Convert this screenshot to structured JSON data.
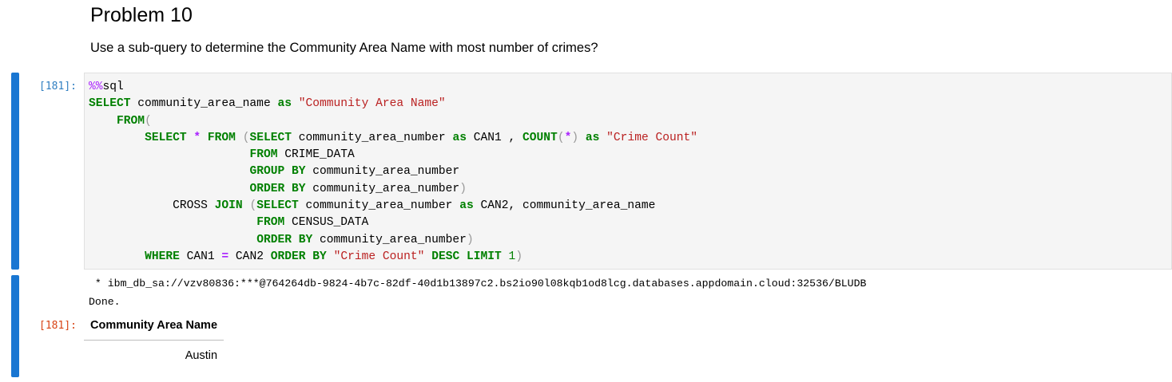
{
  "markdown": {
    "title": "Problem 10",
    "question": "Use a sub-query to determine the Community Area Name with most number of crimes?"
  },
  "cell": {
    "input_prompt": "[181]:",
    "output_prompt": "[181]:",
    "code_lines": [
      [
        [
          "magic",
          "%%"
        ],
        [
          "plain",
          "sql"
        ]
      ],
      [
        [
          "kw",
          "SELECT"
        ],
        [
          "plain",
          " community_area_name "
        ],
        [
          "kw",
          "as"
        ],
        [
          "plain",
          " "
        ],
        [
          "str",
          "\"Community Area Name\""
        ]
      ],
      [
        [
          "plain",
          "    "
        ],
        [
          "kw",
          "FROM"
        ],
        [
          "paren",
          "("
        ]
      ],
      [
        [
          "plain",
          "        "
        ],
        [
          "kw",
          "SELECT"
        ],
        [
          "plain",
          " "
        ],
        [
          "op",
          "*"
        ],
        [
          "plain",
          " "
        ],
        [
          "kw",
          "FROM"
        ],
        [
          "plain",
          " "
        ],
        [
          "paren",
          "("
        ],
        [
          "kw",
          "SELECT"
        ],
        [
          "plain",
          " community_area_number "
        ],
        [
          "kw",
          "as"
        ],
        [
          "plain",
          " CAN1 , "
        ],
        [
          "kw",
          "COUNT"
        ],
        [
          "paren",
          "("
        ],
        [
          "op",
          "*"
        ],
        [
          "paren",
          ")"
        ],
        [
          "plain",
          " "
        ],
        [
          "kw",
          "as"
        ],
        [
          "plain",
          " "
        ],
        [
          "str",
          "\"Crime Count\""
        ]
      ],
      [
        [
          "plain",
          "                       "
        ],
        [
          "kw",
          "FROM"
        ],
        [
          "plain",
          " CRIME_DATA"
        ]
      ],
      [
        [
          "plain",
          "                       "
        ],
        [
          "kw",
          "GROUP"
        ],
        [
          "plain",
          " "
        ],
        [
          "kw",
          "BY"
        ],
        [
          "plain",
          " community_area_number"
        ]
      ],
      [
        [
          "plain",
          "                       "
        ],
        [
          "kw",
          "ORDER"
        ],
        [
          "plain",
          " "
        ],
        [
          "kw",
          "BY"
        ],
        [
          "plain",
          " community_area_number"
        ],
        [
          "paren",
          ")"
        ]
      ],
      [
        [
          "plain",
          "            CROSS "
        ],
        [
          "kw",
          "JOIN"
        ],
        [
          "plain",
          " "
        ],
        [
          "paren",
          "("
        ],
        [
          "kw",
          "SELECT"
        ],
        [
          "plain",
          " community_area_number "
        ],
        [
          "kw",
          "as"
        ],
        [
          "plain",
          " CAN2, community_area_name"
        ]
      ],
      [
        [
          "plain",
          "                        "
        ],
        [
          "kw",
          "FROM"
        ],
        [
          "plain",
          " CENSUS_DATA"
        ]
      ],
      [
        [
          "plain",
          "                        "
        ],
        [
          "kw",
          "ORDER"
        ],
        [
          "plain",
          " "
        ],
        [
          "kw",
          "BY"
        ],
        [
          "plain",
          " community_area_number"
        ],
        [
          "paren",
          ")"
        ]
      ],
      [
        [
          "plain",
          "        "
        ],
        [
          "kw",
          "WHERE"
        ],
        [
          "plain",
          " CAN1 "
        ],
        [
          "op",
          "="
        ],
        [
          "plain",
          " CAN2 "
        ],
        [
          "kw",
          "ORDER"
        ],
        [
          "plain",
          " "
        ],
        [
          "kw",
          "BY"
        ],
        [
          "plain",
          " "
        ],
        [
          "str",
          "\"Crime Count\""
        ],
        [
          "plain",
          " "
        ],
        [
          "kw",
          "DESC"
        ],
        [
          "plain",
          " "
        ],
        [
          "kw",
          "LIMIT"
        ],
        [
          "plain",
          " "
        ],
        [
          "num",
          "1"
        ],
        [
          "paren",
          ")"
        ]
      ]
    ],
    "output": {
      "connection": " * ibm_db_sa://vzv80836:***@764264db-9824-4b7c-82df-40d1b13897c2.bs2io90l08kqb1od8lcg.databases.appdomain.cloud:32536/BLUDB",
      "status": "Done.",
      "table": {
        "columns": [
          "Community Area Name"
        ],
        "rows": [
          [
            "Austin"
          ]
        ]
      }
    }
  },
  "colors": {
    "cell_bar": "#1976d2",
    "input_prompt": "#307fc1",
    "output_prompt": "#d84315",
    "keyword": "#008000",
    "string": "#ba2121",
    "operator": "#aa22ff"
  }
}
